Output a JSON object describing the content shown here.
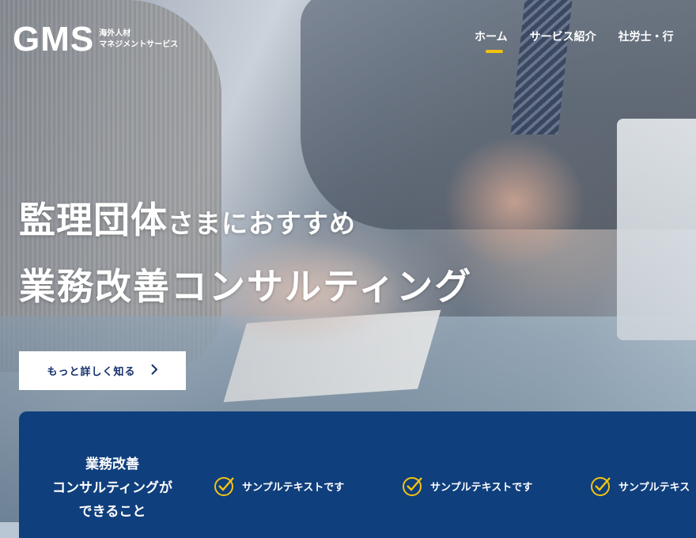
{
  "brand": {
    "logo": "GMS",
    "tagline_line1": "海外人材",
    "tagline_line2": "マネジメントサービス"
  },
  "nav": {
    "items": [
      {
        "label": "ホーム",
        "active": true
      },
      {
        "label": "サービス紹介"
      },
      {
        "label": "社労士・行"
      }
    ]
  },
  "hero": {
    "line1_large": "監理団体",
    "line1_small": "さまにおすすめ",
    "line2": "業務改善コンサルティング",
    "cta_label": "もっと詳しく知る",
    "cta_icon": "chevron-right-icon"
  },
  "panel": {
    "title_line1": "業務改善",
    "title_line2": "コンサルティングが",
    "title_line3": "できること",
    "features": [
      {
        "text": "サンプルテキストです"
      },
      {
        "text": "サンプルテキストです"
      },
      {
        "text": "サンプルテキス"
      }
    ]
  },
  "colors": {
    "accent": "#f2c40f",
    "panel_bg": "#103f7d",
    "cta_text": "#14306a"
  }
}
